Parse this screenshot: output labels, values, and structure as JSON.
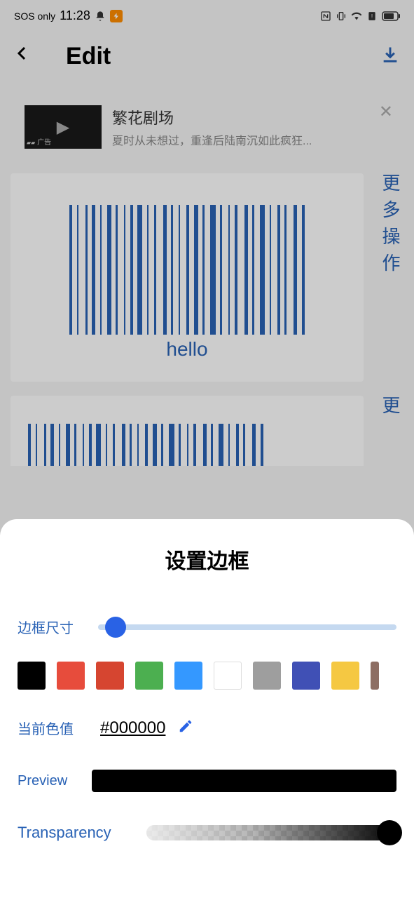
{
  "status": {
    "network": "SOS only",
    "time": "11:28"
  },
  "header": {
    "title": "Edit"
  },
  "ad": {
    "title": "繁花剧场",
    "desc": "夏时从未想过，重逢后陆南沉如此疯狂...",
    "label": "广告"
  },
  "barcode": {
    "label": "hello"
  },
  "sideActions": {
    "more": "更多操作",
    "more2": "更"
  },
  "sheet": {
    "title": "设置边框",
    "borderSize": "边框尺寸",
    "currentColor": "当前色值",
    "colorValue": "#000000",
    "preview": "Preview",
    "transparency": "Transparency",
    "colors": [
      "#000000",
      "#e74c3c",
      "#d64530",
      "#4caf50",
      "#3498ff",
      "#ffffff",
      "#9e9e9e",
      "#4050b5",
      "#f5c842",
      "#8d6e63"
    ]
  }
}
